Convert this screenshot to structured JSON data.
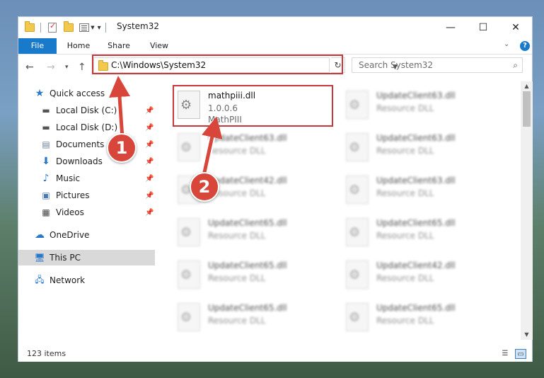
{
  "window": {
    "title": "System32",
    "controls": {
      "minimize": "—",
      "maximize": "☐",
      "close": "✕"
    }
  },
  "ribbon": {
    "tabs": [
      "File",
      "Home",
      "Share",
      "View"
    ],
    "help": "?"
  },
  "address": {
    "path": "C:\\Windows\\System32"
  },
  "search": {
    "placeholder": "Search System32"
  },
  "nav": {
    "items": [
      {
        "label": "Quick access",
        "icon": "star-icon",
        "pinned": false
      },
      {
        "label": "Local Disk (C:)",
        "icon": "drive-icon",
        "pinned": true
      },
      {
        "label": "Local Disk (D:)",
        "icon": "drive-icon",
        "pinned": true
      },
      {
        "label": "Documents",
        "icon": "documents-icon",
        "pinned": true
      },
      {
        "label": "Downloads",
        "icon": "download-icon",
        "pinned": true
      },
      {
        "label": "Music",
        "icon": "music-icon",
        "pinned": true
      },
      {
        "label": "Pictures",
        "icon": "pictures-icon",
        "pinned": true
      },
      {
        "label": "Videos",
        "icon": "videos-icon",
        "pinned": true
      },
      {
        "label": "OneDrive",
        "icon": "cloud-icon",
        "pinned": false
      },
      {
        "label": "This PC",
        "icon": "computer-icon",
        "pinned": false,
        "selected": true
      },
      {
        "label": "Network",
        "icon": "network-icon",
        "pinned": false
      }
    ]
  },
  "files": [
    {
      "name": "mathpiii.dll",
      "line1": "1.0.0.6",
      "line2": "MathPIII",
      "blurred": false
    },
    {
      "name": "UpdateClient63.dll",
      "line1": "Resource DLL",
      "blurred": true
    },
    {
      "name": "UpdateClient63.dll",
      "line1": "Resource DLL",
      "blurred": true
    },
    {
      "name": "UpdateClient63.dll",
      "line1": "Resource DLL",
      "blurred": true
    },
    {
      "name": "UpdateClient42.dll",
      "line1": "Resource DLL",
      "blurred": true
    },
    {
      "name": "UpdateClient63.dll",
      "line1": "Resource DLL",
      "blurred": true
    },
    {
      "name": "UpdateClient65.dll",
      "line1": "Resource DLL",
      "blurred": true
    },
    {
      "name": "UpdateClient65.dll",
      "line1": "Resource DLL",
      "blurred": true
    },
    {
      "name": "UpdateClient65.dll",
      "line1": "Resource DLL",
      "blurred": true
    },
    {
      "name": "UpdateClient42.dll",
      "line1": "Resource DLL",
      "blurred": true
    },
    {
      "name": "UpdateClient65.dll",
      "line1": "Resource DLL",
      "blurred": true
    },
    {
      "name": "UpdateClient65.dll",
      "line1": "Resource DLL",
      "blurred": true
    }
  ],
  "status": {
    "items": "123 items"
  },
  "callouts": [
    "1",
    "2"
  ],
  "colors": {
    "accent": "#1979ca",
    "annotation": "#c9373a",
    "callout": "#d8463b"
  }
}
